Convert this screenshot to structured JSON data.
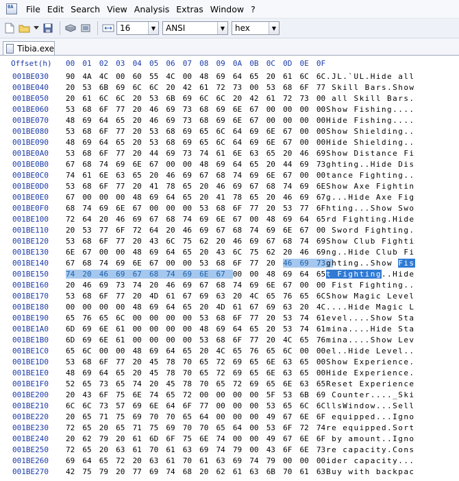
{
  "menu": [
    "File",
    "Edit",
    "Search",
    "View",
    "Analysis",
    "Extras",
    "Window",
    "?"
  ],
  "toolbar": {
    "bytes_per_row": "16",
    "charset": "ANSI",
    "display": "hex"
  },
  "tab": {
    "title": "Tibia.exe"
  },
  "hex": {
    "offset_header": "Offset(h)",
    "columns": [
      "00",
      "01",
      "02",
      "03",
      "04",
      "05",
      "06",
      "07",
      "08",
      "09",
      "0A",
      "0B",
      "0C",
      "0D",
      "0E",
      "0F"
    ],
    "rows": [
      {
        "o": "001BE030",
        "b": "90 4A 4C 00 60 55 4C 00 48 69 64 65 20 61 6C 6C",
        "a": ".JL.`UL.Hide all"
      },
      {
        "o": "001BE040",
        "b": "20 53 6B 69 6C 6C 20 42 61 72 73 00 53 68 6F 77",
        "a": " Skill Bars.Show"
      },
      {
        "o": "001BE050",
        "b": "20 61 6C 6C 20 53 6B 69 6C 6C 20 42 61 72 73 00",
        "a": " all Skill Bars."
      },
      {
        "o": "001BE060",
        "b": "53 68 6F 77 20 46 69 73 68 69 6E 67 00 00 00 00",
        "a": "Show Fishing...."
      },
      {
        "o": "001BE070",
        "b": "48 69 64 65 20 46 69 73 68 69 6E 67 00 00 00 00",
        "a": "Hide Fishing...."
      },
      {
        "o": "001BE080",
        "b": "53 68 6F 77 20 53 68 69 65 6C 64 69 6E 67 00 00",
        "a": "Show Shielding.."
      },
      {
        "o": "001BE090",
        "b": "48 69 64 65 20 53 68 69 65 6C 64 69 6E 67 00 00",
        "a": "Hide Shielding.."
      },
      {
        "o": "001BE0A0",
        "b": "53 68 6F 77 20 44 69 73 74 61 6E 63 65 20 46 69",
        "a": "Show Distance Fi"
      },
      {
        "o": "001BE0B0",
        "b": "67 68 74 69 6E 67 00 00 48 69 64 65 20 44 69 73",
        "a": "ghting..Hide Dis"
      },
      {
        "o": "001BE0C0",
        "b": "74 61 6E 63 65 20 46 69 67 68 74 69 6E 67 00 00",
        "a": "tance Fighting.."
      },
      {
        "o": "001BE0D0",
        "b": "53 68 6F 77 20 41 78 65 20 46 69 67 68 74 69 6E",
        "a": "Show Axe Fightin"
      },
      {
        "o": "001BE0E0",
        "b": "67 00 00 00 48 69 64 65 20 41 78 65 20 46 69 67",
        "a": "g...Hide Axe Fig"
      },
      {
        "o": "001BE0F0",
        "b": "68 74 69 6E 67 00 00 00 53 68 6F 77 20 53 77 6F",
        "a": "hting...Show Swo"
      },
      {
        "o": "001BE100",
        "b": "72 64 20 46 69 67 68 74 69 6E 67 00 48 69 64 65",
        "a": "rd Fighting.Hide"
      },
      {
        "o": "001BE110",
        "b": "20 53 77 6F 72 64 20 46 69 67 68 74 69 6E 67 00",
        "a": " Sword Fighting."
      },
      {
        "o": "001BE120",
        "b": "53 68 6F 77 20 43 6C 75 62 20 46 69 67 68 74 69",
        "a": "Show Club Fighti"
      },
      {
        "o": "001BE130",
        "b": "6E 67 00 00 48 69 64 65 20 43 6C 75 62 20 46 69",
        "a": "ng..Hide Club Fi"
      },
      {
        "o": "001BE140",
        "b": "67 68 74 69 6E 67 00 00 53 68 6F 77 20 46 69 73",
        "a": "ghting..Show Fis"
      },
      {
        "o": "001BE150",
        "b": "74 20 46 69 67 68 74 69 6E 67 00 00 48 69 64 65",
        "a": "t Fighting..Hide"
      },
      {
        "o": "001BE160",
        "b": "20 46 69 73 74 20 46 69 67 68 74 69 6E 67 00 00",
        "a": " Fist Fighting.."
      },
      {
        "o": "001BE170",
        "b": "53 68 6F 77 20 4D 61 67 69 63 20 4C 65 76 65 6C",
        "a": "Show Magic Level"
      },
      {
        "o": "001BE180",
        "b": "00 00 00 00 48 69 64 65 20 4D 61 67 69 63 20 4C",
        "a": "....Hide Magic L"
      },
      {
        "o": "001BE190",
        "b": "65 76 65 6C 00 00 00 00 53 68 6F 77 20 53 74 61",
        "a": "evel....Show Sta"
      },
      {
        "o": "001BE1A0",
        "b": "6D 69 6E 61 00 00 00 00 48 69 64 65 20 53 74 61",
        "a": "mina....Hide Sta"
      },
      {
        "o": "001BE1B0",
        "b": "6D 69 6E 61 00 00 00 00 53 68 6F 77 20 4C 65 76",
        "a": "mina....Show Lev"
      },
      {
        "o": "001BE1C0",
        "b": "65 6C 00 00 48 69 64 65 20 4C 65 76 65 6C 00 00",
        "a": "el..Hide Level.."
      },
      {
        "o": "001BE1D0",
        "b": "53 68 6F 77 20 45 78 70 65 72 69 65 6E 63 65 00",
        "a": "Show Experience."
      },
      {
        "o": "001BE1E0",
        "b": "48 69 64 65 20 45 78 70 65 72 69 65 6E 63 65 00",
        "a": "Hide Experience."
      },
      {
        "o": "001BE1F0",
        "b": "52 65 73 65 74 20 45 78 70 65 72 69 65 6E 63 65",
        "a": "Reset Experience"
      },
      {
        "o": "001BE200",
        "b": "20 43 6F 75 6E 74 65 72 00 00 00 00 5F 53 6B 69",
        "a": " Counter...._Ski"
      },
      {
        "o": "001BE210",
        "b": "6C 6C 73 57 69 6E 64 6F 77 00 00 00 53 65 6C 6C",
        "a": "llsWindow...Sell"
      },
      {
        "o": "001BE220",
        "b": "20 65 71 75 69 70 70 65 64 00 00 00 49 67 6E 6F",
        "a": " equipped...Igno"
      },
      {
        "o": "001BE230",
        "b": "72 65 20 65 71 75 69 70 70 65 64 00 53 6F 72 74",
        "a": "re equipped.Sort"
      },
      {
        "o": "001BE240",
        "b": "20 62 79 20 61 6D 6F 75 6E 74 00 00 49 67 6E 6F",
        "a": " by amount..Igno"
      },
      {
        "o": "001BE250",
        "b": "72 65 20 63 61 70 61 63 69 74 79 00 43 6F 6E 73",
        "a": "re capacity.Cons"
      },
      {
        "o": "001BE260",
        "b": "69 64 65 72 20 63 61 70 61 63 69 74 79 00 00 00",
        "a": "ider capacity..."
      },
      {
        "o": "001BE270",
        "b": "42 75 79 20 77 69 74 68 20 62 61 63 6B 70 61 63",
        "a": "Buy with backpac"
      }
    ]
  },
  "selection": {
    "start_offset": "001BE14D",
    "end_offset": "001BE159"
  }
}
